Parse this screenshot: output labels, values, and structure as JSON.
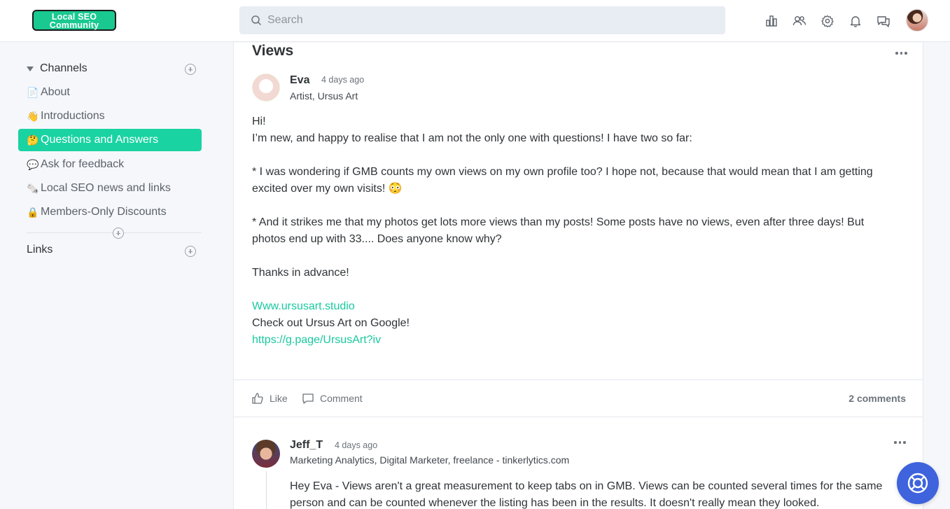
{
  "header": {
    "logo_line1": "Local SEO",
    "logo_line2": "Community",
    "search_placeholder": "Search",
    "icons": [
      "leaderboard-icon",
      "members-icon",
      "settings-icon",
      "notifications-icon",
      "messages-icon",
      "user-avatar"
    ]
  },
  "sidebar": {
    "channels_label": "Channels",
    "links_label": "Links",
    "items": [
      {
        "emoji": "📄",
        "label": "About"
      },
      {
        "emoji": "👋",
        "label": "Introductions"
      },
      {
        "emoji": "🤔",
        "label": "Questions and Answers"
      },
      {
        "emoji": "💬",
        "label": "Ask for feedback"
      },
      {
        "emoji": "🗞️",
        "label": "Local SEO news and links"
      },
      {
        "emoji": "🔒",
        "label": "Members-Only Discounts"
      }
    ],
    "active_index": 2
  },
  "post": {
    "title": "Views",
    "author": "Eva",
    "time": "4 days ago",
    "role": "Artist, Ursus Art",
    "lines": [
      "Hi!",
      "I’m new, and happy to realise that I am not the only one with questions! I have two so far:",
      " * I was wondering if GMB counts my own views on my own profile too? I hope not, because that would mean that I am getting",
      "excited over my own visits! 😳",
      "* And it strikes me that my photos get lots more views than my posts! Some posts have no views, even after three days! But",
      "photos end up with 33.... Does anyone know why?",
      "Thanks in advance!",
      "Www.ursusart.studio",
      "Check out Ursus Art on Google!",
      "https://g.page/UrsusArt?iv"
    ],
    "like_label": "Like",
    "comment_label": "Comment",
    "comments_count": "2 comments"
  },
  "comment": {
    "author": "Jeff_T",
    "time": "4 days ago",
    "role": "Marketing Analytics, Digital Marketer, freelance - tinkerlytics.com",
    "lines": [
      "Hey Eva - Views aren't a great measurement to keep tabs on in GMB. Views can be counted several times for the same",
      "person and can be counted whenever the listing has been in the results. It doesn't really mean they looked."
    ]
  },
  "colors": {
    "accent": "#19d3a2",
    "link": "#19c9a0",
    "help_button": "#3e63dd"
  }
}
